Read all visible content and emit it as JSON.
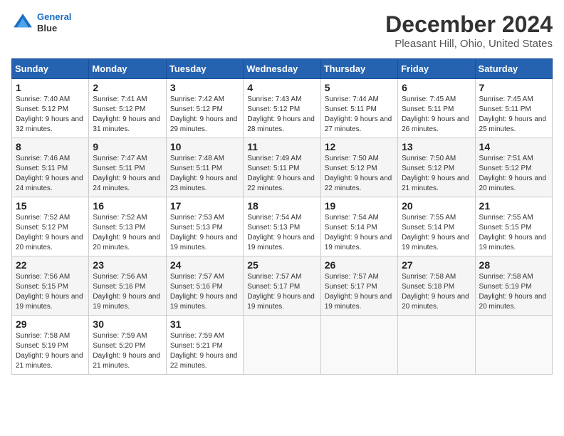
{
  "header": {
    "logo_line1": "General",
    "logo_line2": "Blue",
    "main_title": "December 2024",
    "subtitle": "Pleasant Hill, Ohio, United States"
  },
  "calendar": {
    "days_of_week": [
      "Sunday",
      "Monday",
      "Tuesday",
      "Wednesday",
      "Thursday",
      "Friday",
      "Saturday"
    ],
    "weeks": [
      [
        {
          "day": "1",
          "sunrise": "7:40 AM",
          "sunset": "5:12 PM",
          "daylight": "9 hours and 32 minutes."
        },
        {
          "day": "2",
          "sunrise": "7:41 AM",
          "sunset": "5:12 PM",
          "daylight": "9 hours and 31 minutes."
        },
        {
          "day": "3",
          "sunrise": "7:42 AM",
          "sunset": "5:12 PM",
          "daylight": "9 hours and 29 minutes."
        },
        {
          "day": "4",
          "sunrise": "7:43 AM",
          "sunset": "5:12 PM",
          "daylight": "9 hours and 28 minutes."
        },
        {
          "day": "5",
          "sunrise": "7:44 AM",
          "sunset": "5:11 PM",
          "daylight": "9 hours and 27 minutes."
        },
        {
          "day": "6",
          "sunrise": "7:45 AM",
          "sunset": "5:11 PM",
          "daylight": "9 hours and 26 minutes."
        },
        {
          "day": "7",
          "sunrise": "7:45 AM",
          "sunset": "5:11 PM",
          "daylight": "9 hours and 25 minutes."
        }
      ],
      [
        {
          "day": "8",
          "sunrise": "7:46 AM",
          "sunset": "5:11 PM",
          "daylight": "9 hours and 24 minutes."
        },
        {
          "day": "9",
          "sunrise": "7:47 AM",
          "sunset": "5:11 PM",
          "daylight": "9 hours and 24 minutes."
        },
        {
          "day": "10",
          "sunrise": "7:48 AM",
          "sunset": "5:11 PM",
          "daylight": "9 hours and 23 minutes."
        },
        {
          "day": "11",
          "sunrise": "7:49 AM",
          "sunset": "5:11 PM",
          "daylight": "9 hours and 22 minutes."
        },
        {
          "day": "12",
          "sunrise": "7:50 AM",
          "sunset": "5:12 PM",
          "daylight": "9 hours and 22 minutes."
        },
        {
          "day": "13",
          "sunrise": "7:50 AM",
          "sunset": "5:12 PM",
          "daylight": "9 hours and 21 minutes."
        },
        {
          "day": "14",
          "sunrise": "7:51 AM",
          "sunset": "5:12 PM",
          "daylight": "9 hours and 20 minutes."
        }
      ],
      [
        {
          "day": "15",
          "sunrise": "7:52 AM",
          "sunset": "5:12 PM",
          "daylight": "9 hours and 20 minutes."
        },
        {
          "day": "16",
          "sunrise": "7:52 AM",
          "sunset": "5:13 PM",
          "daylight": "9 hours and 20 minutes."
        },
        {
          "day": "17",
          "sunrise": "7:53 AM",
          "sunset": "5:13 PM",
          "daylight": "9 hours and 19 minutes."
        },
        {
          "day": "18",
          "sunrise": "7:54 AM",
          "sunset": "5:13 PM",
          "daylight": "9 hours and 19 minutes."
        },
        {
          "day": "19",
          "sunrise": "7:54 AM",
          "sunset": "5:14 PM",
          "daylight": "9 hours and 19 minutes."
        },
        {
          "day": "20",
          "sunrise": "7:55 AM",
          "sunset": "5:14 PM",
          "daylight": "9 hours and 19 minutes."
        },
        {
          "day": "21",
          "sunrise": "7:55 AM",
          "sunset": "5:15 PM",
          "daylight": "9 hours and 19 minutes."
        }
      ],
      [
        {
          "day": "22",
          "sunrise": "7:56 AM",
          "sunset": "5:15 PM",
          "daylight": "9 hours and 19 minutes."
        },
        {
          "day": "23",
          "sunrise": "7:56 AM",
          "sunset": "5:16 PM",
          "daylight": "9 hours and 19 minutes."
        },
        {
          "day": "24",
          "sunrise": "7:57 AM",
          "sunset": "5:16 PM",
          "daylight": "9 hours and 19 minutes."
        },
        {
          "day": "25",
          "sunrise": "7:57 AM",
          "sunset": "5:17 PM",
          "daylight": "9 hours and 19 minutes."
        },
        {
          "day": "26",
          "sunrise": "7:57 AM",
          "sunset": "5:17 PM",
          "daylight": "9 hours and 19 minutes."
        },
        {
          "day": "27",
          "sunrise": "7:58 AM",
          "sunset": "5:18 PM",
          "daylight": "9 hours and 20 minutes."
        },
        {
          "day": "28",
          "sunrise": "7:58 AM",
          "sunset": "5:19 PM",
          "daylight": "9 hours and 20 minutes."
        }
      ],
      [
        {
          "day": "29",
          "sunrise": "7:58 AM",
          "sunset": "5:19 PM",
          "daylight": "9 hours and 21 minutes."
        },
        {
          "day": "30",
          "sunrise": "7:59 AM",
          "sunset": "5:20 PM",
          "daylight": "9 hours and 21 minutes."
        },
        {
          "day": "31",
          "sunrise": "7:59 AM",
          "sunset": "5:21 PM",
          "daylight": "9 hours and 22 minutes."
        },
        null,
        null,
        null,
        null
      ]
    ],
    "labels": {
      "sunrise": "Sunrise:",
      "sunset": "Sunset:",
      "daylight": "Daylight:"
    }
  }
}
